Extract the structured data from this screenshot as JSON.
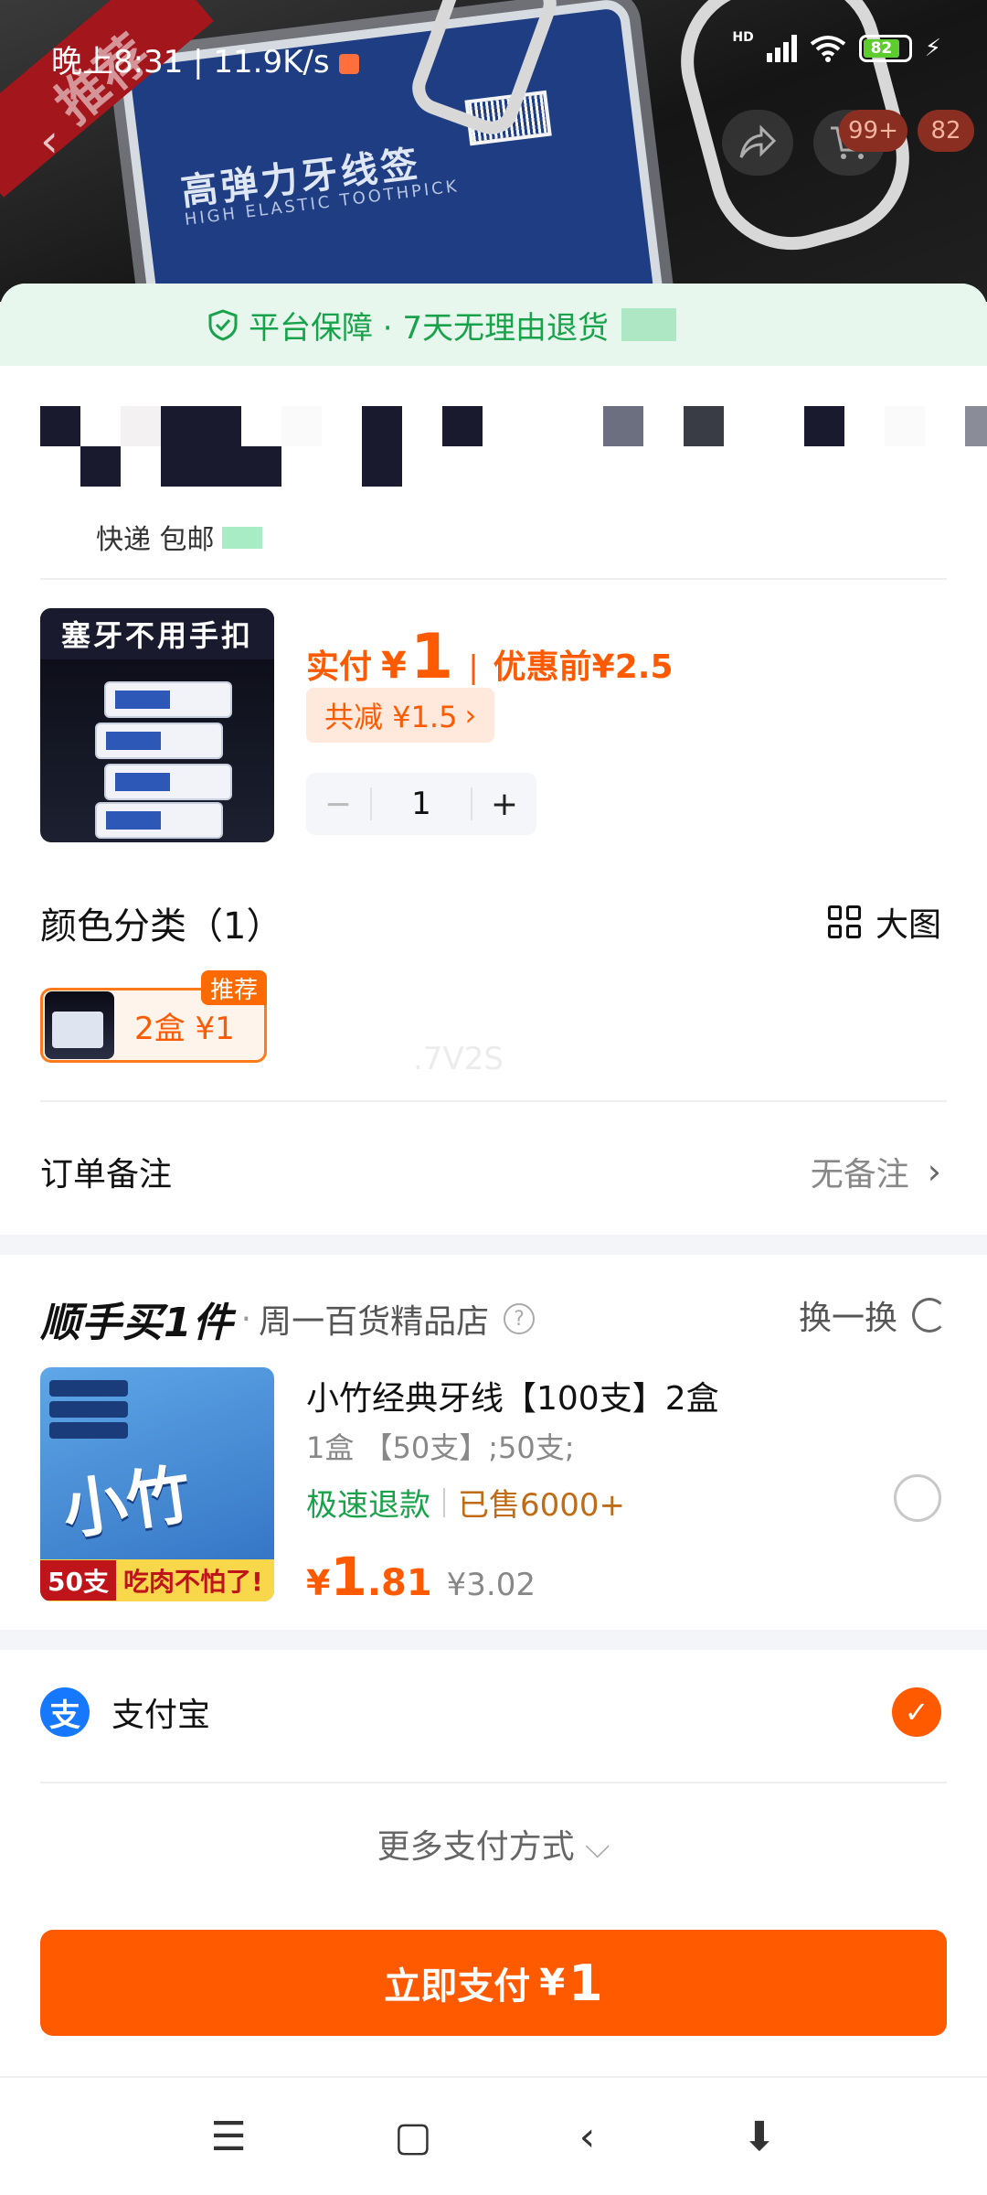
{
  "status_bar": {
    "time": "晚上8:31 | 11.9K/s",
    "network": "HD",
    "battery": "82"
  },
  "hero": {
    "ribbon": "推荐",
    "box_title": "高弹力牙线签",
    "box_subtitle": "HIGH ELASTIC TOOTHPICK"
  },
  "nav": {
    "back_icon": "chevron-left-icon",
    "share_icon": "share-icon",
    "cart_icon": "cart-icon",
    "cart_badge": "99+",
    "message_badge": "82"
  },
  "guarantee": {
    "text": "平台保障 · 7天无理由退货"
  },
  "shipping": {
    "text": "快递 包邮"
  },
  "product": {
    "image_tag": "塞牙不用手扣",
    "paid_label": "实付",
    "currency": "¥",
    "paid_amount": "1",
    "before_label": "优惠前",
    "before_amount": "¥2.5",
    "discount": "共减 ¥1.5",
    "quantity": "1",
    "minus": "−",
    "plus": "+"
  },
  "color_section": {
    "title": "颜色分类（1）",
    "view_label": "大图",
    "variant_text": "2盒  ¥1",
    "variant_badge": "推荐",
    "watermark": ".7V2S"
  },
  "order_note": {
    "label": "订单备注",
    "value": "无备注"
  },
  "upsell": {
    "brand": "顺手买1件",
    "shop": "周一百货精品店",
    "help": "?",
    "swap_label": "换一换",
    "title": "小竹经典牙线【100支】2盒",
    "spec": "1盒 【50支】;50支;",
    "fast_refund": "极速退款",
    "sold": "已售6000+",
    "price_yen": "¥",
    "price_int": "1",
    "price_dec": ".81",
    "original_price": "¥3.02",
    "image_brand": "小竹",
    "image_strip_count": "50支",
    "image_strip_text": "吃肉不怕了!"
  },
  "payment": {
    "method": "支付宝",
    "alipay_glyph": "支",
    "more": "更多支付方式",
    "button_label": "立即支付",
    "button_currency": "¥",
    "button_amount": "1"
  },
  "system_nav": {
    "menu": "☰",
    "home": "▢",
    "back": "‹",
    "assistant": "⬇"
  },
  "colors": {
    "accent": "#ff5a00",
    "green": "#18a34a",
    "alipay": "#1677ff"
  }
}
